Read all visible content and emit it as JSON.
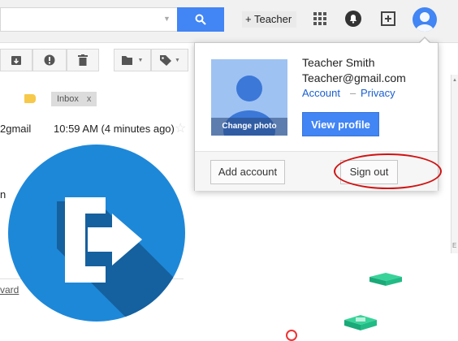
{
  "topbar": {
    "add_label": "+ Teacher"
  },
  "mail": {
    "label_chip": "Inbox",
    "label_close": "x",
    "sender_fragment": "2gmail",
    "time": "10:59 AM (4 minutes ago)",
    "body_fragment": "n",
    "link_fragment": "vard"
  },
  "popup": {
    "name": "Teacher Smith",
    "email": "Teacher@gmail.com",
    "account_link": "Account",
    "separator": "–",
    "privacy_link": "Privacy",
    "change_photo": "Change photo",
    "view_profile": "View profile",
    "add_account": "Add account",
    "sign_out": "Sign out"
  },
  "colors": {
    "accent_blue": "#4285f4",
    "highlight_red": "#d11212",
    "logout_badge": "#1e88d8"
  },
  "icons": [
    "search-icon",
    "apps-grid-icon",
    "notification-bell-icon",
    "add-share-icon",
    "account-avatar-icon",
    "archive-icon",
    "report-spam-icon",
    "delete-icon",
    "move-to-folder-icon",
    "label-tag-icon",
    "sign-out-icon"
  ]
}
